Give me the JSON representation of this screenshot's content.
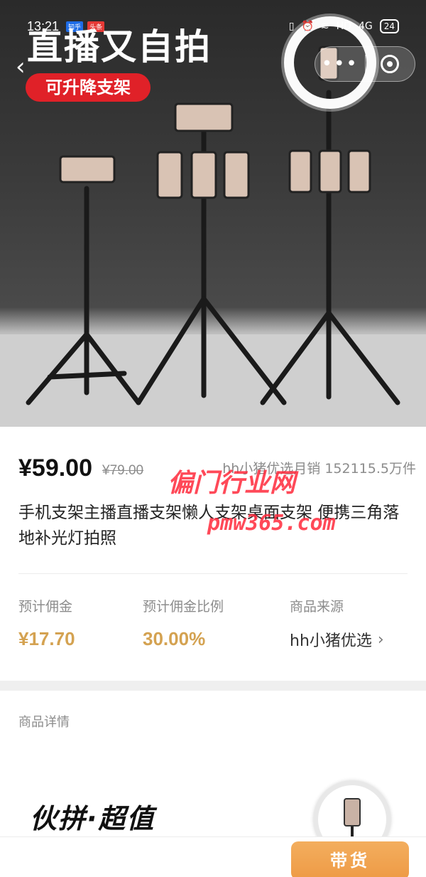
{
  "status_bar": {
    "time": "13:21",
    "notif_1": "知乎",
    "notif_2": "头条",
    "network": "HD",
    "signal": "4G",
    "battery": "24"
  },
  "hero": {
    "title": "直播又自拍",
    "tag": "可升降支架",
    "capsule_more": "•••",
    "background_color": "#2f2f2f"
  },
  "price": {
    "current": "¥59.00",
    "original": "¥79.00",
    "sales": "hh小猪优选月销 152115.5万件"
  },
  "product": {
    "title": "手机支架主播直播支架懒人支架桌面支架 便携三角落地补光灯拍照"
  },
  "watermark": {
    "line1": "偏门行业网",
    "line2": "pmw365.com"
  },
  "stats": {
    "commission_label": "预计佣金",
    "commission_value": "¥17.70",
    "ratio_label": "预计佣金比例",
    "ratio_value": "30.00%",
    "source_label": "商品来源",
    "source_value": "hh小猪优选",
    "accent_color": "#d4a251"
  },
  "detail": {
    "label": "商品详情",
    "banner_text": "伙拼·超值"
  },
  "cta": {
    "label": "带货",
    "color": "#ef9d49"
  }
}
